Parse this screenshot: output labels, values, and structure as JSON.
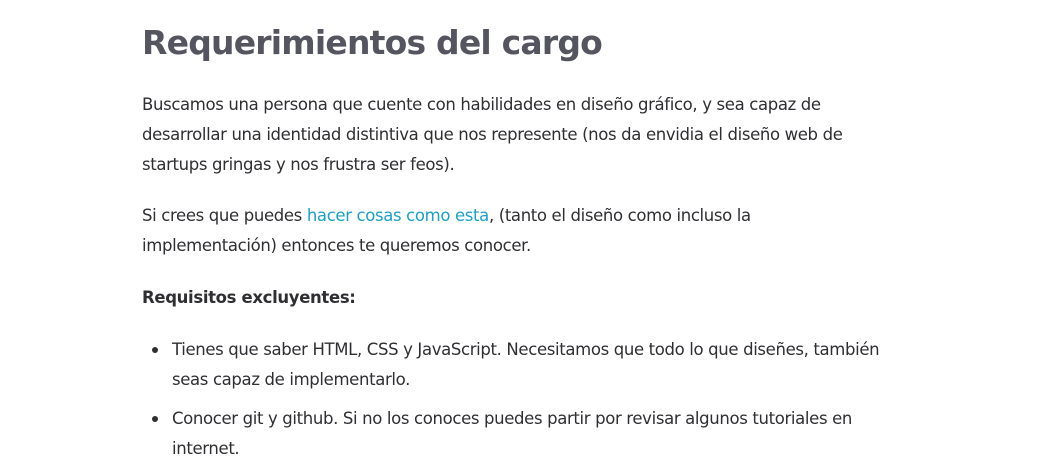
{
  "section": {
    "heading": "Requerimientos del cargo",
    "paragraph1": "Buscamos una persona que cuente con habilidades en diseño gráfico, y sea capaz de desarrollar una identidad distintiva que nos represente (nos da envidia el diseño web de startups gringas y nos frustra ser feos).",
    "paragraph2": {
      "before": "Si crees que puedes ",
      "link_text": "hacer cosas como esta",
      "after": ", (tanto el diseño como incluso la implementación) entonces te queremos conocer."
    },
    "requirements_label": "Requisitos excluyentes:",
    "requirements": [
      "Tienes que saber HTML, CSS y JavaScript. Necesitamos que todo lo que diseñes, también seas capaz de implementarlo.",
      "Conocer git y github. Si no los conoces puedes partir por revisar algunos tutoriales en internet."
    ]
  },
  "colors": {
    "heading": "#55555f",
    "text": "#2f2f33",
    "link": "#1aa1c7"
  }
}
